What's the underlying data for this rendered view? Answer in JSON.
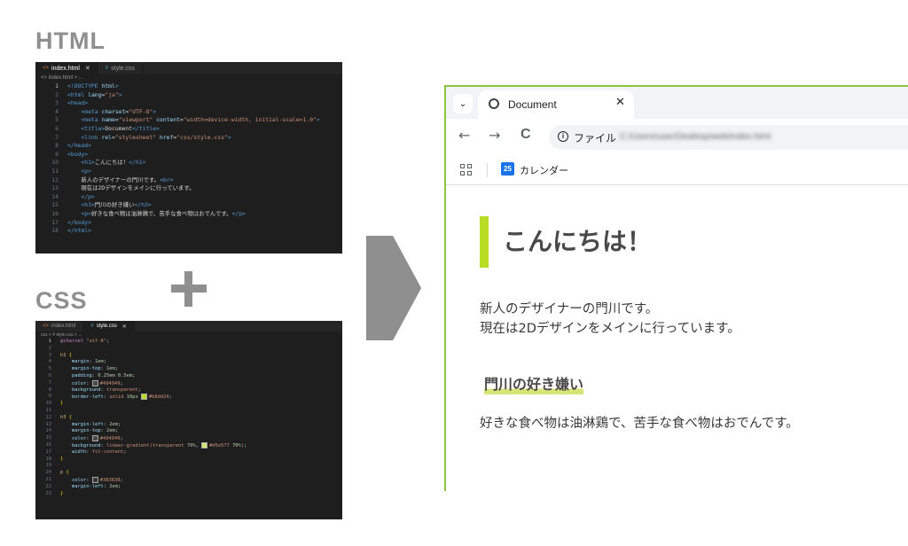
{
  "labels": {
    "html": "HTML",
    "css": "CSS"
  },
  "html_editor": {
    "tabs": [
      {
        "label": "index.html",
        "icon": "<>",
        "active": true
      },
      {
        "label": "style.css",
        "icon": "#",
        "active": false
      }
    ],
    "breadcrumb": "<> index.html > ...",
    "lines": [
      [
        [
          "tag",
          "<!DOCTYPE "
        ],
        [
          "attr",
          "html"
        ],
        [
          "tag",
          ">"
        ]
      ],
      [
        [
          "tag",
          "<html "
        ],
        [
          "attr",
          "lang"
        ],
        [
          "txt",
          "="
        ],
        [
          "str",
          "\"ja\""
        ],
        [
          "tag",
          ">"
        ]
      ],
      [
        [
          "tag",
          "<head>"
        ]
      ],
      [
        [
          "g",
          "    "
        ],
        [
          "tag",
          "<meta "
        ],
        [
          "attr",
          "charset"
        ],
        [
          "txt",
          "="
        ],
        [
          "str",
          "\"UTF-8\""
        ],
        [
          "tag",
          ">"
        ]
      ],
      [
        [
          "g",
          "    "
        ],
        [
          "tag",
          "<meta "
        ],
        [
          "attr",
          "name"
        ],
        [
          "txt",
          "="
        ],
        [
          "str",
          "\"viewport\" "
        ],
        [
          "attr",
          "content"
        ],
        [
          "txt",
          "="
        ],
        [
          "str",
          "\"width=device-width, initial-scale=1.0\""
        ],
        [
          "tag",
          ">"
        ]
      ],
      [
        [
          "g",
          "    "
        ],
        [
          "tag",
          "<title>"
        ],
        [
          "txt",
          "Document"
        ],
        [
          "tag",
          "</title>"
        ]
      ],
      [
        [
          "g",
          "    "
        ],
        [
          "tag",
          "<link "
        ],
        [
          "attr",
          "rel"
        ],
        [
          "txt",
          "="
        ],
        [
          "str",
          "\"stylesheet\" "
        ],
        [
          "attr",
          "href"
        ],
        [
          "txt",
          "="
        ],
        [
          "str",
          "\"css/style.css\""
        ],
        [
          "tag",
          ">"
        ]
      ],
      [
        [
          "tag",
          "</head>"
        ]
      ],
      [
        [
          "tag",
          "<body>"
        ]
      ],
      [
        [
          "g",
          "    "
        ],
        [
          "tag",
          "<h1>"
        ],
        [
          "txt",
          "こんにちは！"
        ],
        [
          "tag",
          "</h1>"
        ]
      ],
      [
        [
          "g",
          "    "
        ],
        [
          "tag",
          "<p>"
        ]
      ],
      [
        [
          "g",
          "    "
        ],
        [
          "txt",
          "新人のデザイナーの門川です。"
        ],
        [
          "tag",
          "<br>"
        ]
      ],
      [
        [
          "g",
          "    "
        ],
        [
          "txt",
          "現在は2Dデザインをメインに行っています。"
        ]
      ],
      [
        [
          "g",
          "    "
        ],
        [
          "tag",
          "</p>"
        ]
      ],
      [
        [
          "g",
          "    "
        ],
        [
          "tag",
          "<h3>"
        ],
        [
          "txt",
          "門川の好き嫌い"
        ],
        [
          "tag",
          "</h3>"
        ]
      ],
      [
        [
          "g",
          "    "
        ],
        [
          "tag",
          "<p>"
        ],
        [
          "txt",
          "好きな食べ物は油淋鶏で、苦手な食べ物はおでんです。"
        ],
        [
          "tag",
          "</p>"
        ]
      ],
      [
        [
          "tag",
          "</body>"
        ]
      ],
      [
        [
          "tag",
          "</html>"
        ]
      ]
    ]
  },
  "css_editor": {
    "tabs": [
      {
        "label": "index.html",
        "icon": "<>",
        "active": false
      },
      {
        "label": "style.css",
        "icon": "#",
        "active": true
      }
    ],
    "breadcrumb": "css > # style.css > ...",
    "lines": [
      [
        [
          "at",
          "@charset "
        ],
        [
          "val",
          "\"utf-8\""
        ],
        [
          "punc",
          ";"
        ]
      ],
      [],
      [
        [
          "sel",
          "h1 "
        ],
        [
          "brace",
          "{"
        ]
      ],
      [
        [
          "g",
          "    "
        ],
        [
          "prop",
          "margin"
        ],
        [
          "punc",
          ": "
        ],
        [
          "num",
          "1em"
        ],
        [
          "punc",
          ";"
        ]
      ],
      [
        [
          "g",
          "    "
        ],
        [
          "prop",
          "margin-top"
        ],
        [
          "punc",
          ": "
        ],
        [
          "num",
          "1em"
        ],
        [
          "punc",
          ";"
        ]
      ],
      [
        [
          "g",
          "    "
        ],
        [
          "prop",
          "padding"
        ],
        [
          "punc",
          ": "
        ],
        [
          "num",
          "0.25em 0.5em"
        ],
        [
          "punc",
          ";"
        ]
      ],
      [
        [
          "g",
          "    "
        ],
        [
          "prop",
          "color"
        ],
        [
          "punc",
          ": "
        ],
        [
          "sw",
          "#494949"
        ],
        [
          "val",
          "#494949"
        ],
        [
          "punc",
          ";"
        ]
      ],
      [
        [
          "g",
          "    "
        ],
        [
          "prop",
          "background"
        ],
        [
          "punc",
          ": "
        ],
        [
          "val",
          "transparent"
        ],
        [
          "punc",
          ";"
        ]
      ],
      [
        [
          "g",
          "    "
        ],
        [
          "prop",
          "border-left"
        ],
        [
          "punc",
          ": "
        ],
        [
          "val",
          "solid "
        ],
        [
          "num",
          "10px "
        ],
        [
          "sw",
          "#b8dd24"
        ],
        [
          "val",
          "#b8dd24"
        ],
        [
          "punc",
          ";"
        ]
      ],
      [
        [
          "brace",
          "}"
        ]
      ],
      [],
      [
        [
          "sel",
          "h3 "
        ],
        [
          "brace",
          "{"
        ]
      ],
      [
        [
          "g",
          "    "
        ],
        [
          "prop",
          "margin-left"
        ],
        [
          "punc",
          ": "
        ],
        [
          "num",
          "2em"
        ],
        [
          "punc",
          ";"
        ]
      ],
      [
        [
          "g",
          "    "
        ],
        [
          "prop",
          "margin-top"
        ],
        [
          "punc",
          ": "
        ],
        [
          "num",
          "2em"
        ],
        [
          "punc",
          ";"
        ]
      ],
      [
        [
          "g",
          "    "
        ],
        [
          "prop",
          "color"
        ],
        [
          "punc",
          ": "
        ],
        [
          "sw",
          "#494949"
        ],
        [
          "val",
          "#494949"
        ],
        [
          "punc",
          ";"
        ]
      ],
      [
        [
          "g",
          "    "
        ],
        [
          "prop",
          "background"
        ],
        [
          "punc",
          ": "
        ],
        [
          "val",
          "linear-gradient("
        ],
        [
          "val",
          "transparent "
        ],
        [
          "num",
          "70%"
        ],
        [
          "punc",
          ", "
        ],
        [
          "sw",
          "#d5e577"
        ],
        [
          "val",
          "#d5e577 "
        ],
        [
          "num",
          "70%"
        ],
        [
          "val",
          ")"
        ],
        [
          "punc",
          ";"
        ]
      ],
      [
        [
          "g",
          "    "
        ],
        [
          "prop",
          "width"
        ],
        [
          "punc",
          ": "
        ],
        [
          "val",
          "fit-content"
        ],
        [
          "punc",
          ";"
        ]
      ],
      [
        [
          "brace",
          "}"
        ]
      ],
      [],
      [
        [
          "sel",
          "p "
        ],
        [
          "brace",
          "{"
        ]
      ],
      [
        [
          "g",
          "    "
        ],
        [
          "prop",
          "color"
        ],
        [
          "punc",
          ": "
        ],
        [
          "sw",
          "#383838"
        ],
        [
          "val",
          "#383838"
        ],
        [
          "punc",
          ";"
        ]
      ],
      [
        [
          "g",
          "    "
        ],
        [
          "prop",
          "margin-left"
        ],
        [
          "punc",
          ": "
        ],
        [
          "num",
          "2em"
        ],
        [
          "punc",
          ";"
        ]
      ],
      [
        [
          "brace",
          "}"
        ]
      ]
    ]
  },
  "browser": {
    "tab_title": "Document",
    "tab_close": "✕",
    "dropdown": "⌄",
    "back": "←",
    "forward": "→",
    "reload": "C",
    "address_prefix": "ファイル",
    "address_url": "C:/Users/user/Desktop/web/index.html",
    "bookmark_calendar_badge": "25",
    "bookmark_calendar": "カレンダー"
  },
  "page": {
    "h1": "こんにちは！",
    "p1_line1": "新人のデザイナーの門川です。",
    "p1_line2": "現在は2Dデザインをメインに行っています。",
    "h3": "門川の好き嫌い",
    "p2": "好きな食べ物は油淋鶏で、苦手な食べ物はおでんです。"
  },
  "colors": {
    "accent_green": "#b8dd24",
    "marker": "#d5e577",
    "heading": "#494949",
    "text": "#383838",
    "frame": "#8cc63f"
  }
}
